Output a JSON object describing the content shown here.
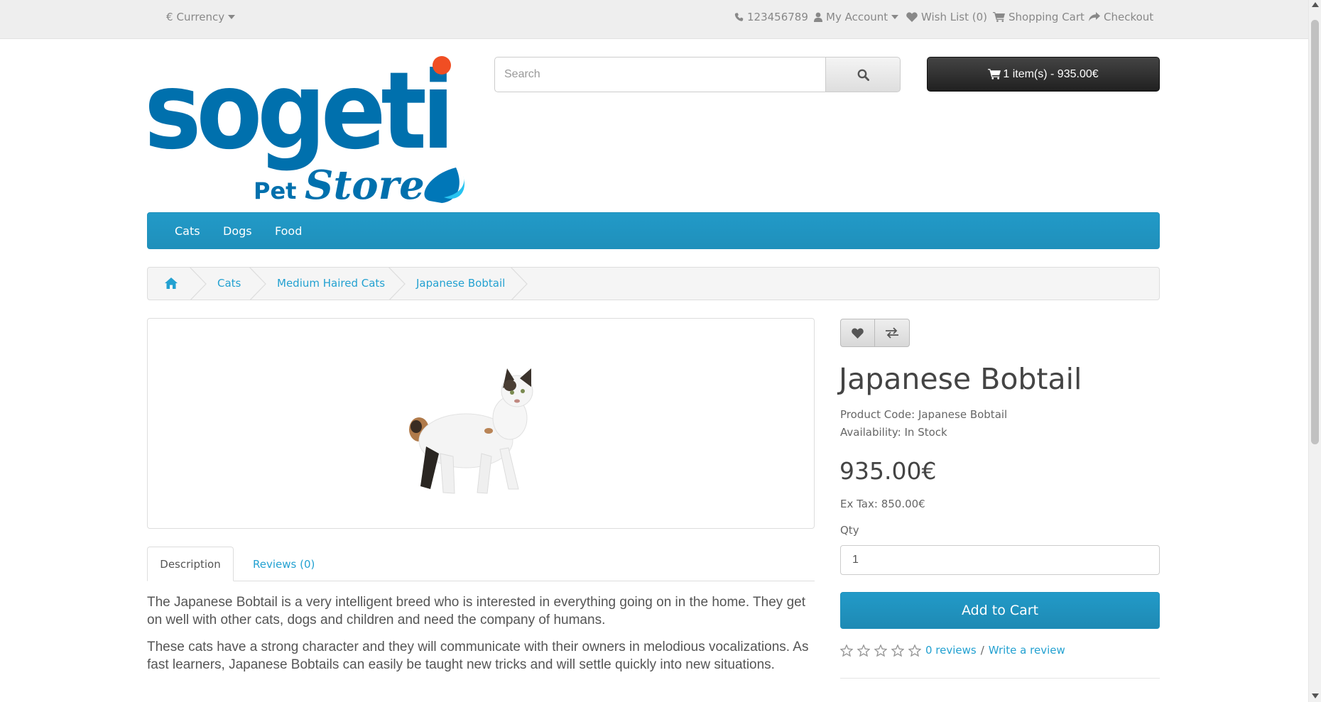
{
  "topbar": {
    "currency_symbol": "€",
    "currency_label": "Currency",
    "phone": "123456789",
    "my_account": "My Account",
    "wish_list": "Wish List (0)",
    "shopping_cart": "Shopping Cart",
    "checkout": "Checkout"
  },
  "logo": {
    "brand": "sogeti",
    "sub1": "Pet",
    "sub2": "Store"
  },
  "search": {
    "placeholder": "Search"
  },
  "cart": {
    "label": "1 item(s) - 935.00€"
  },
  "menu": {
    "items": [
      "Cats",
      "Dogs",
      "Food"
    ]
  },
  "breadcrumb": {
    "items": [
      "Cats",
      "Medium Haired Cats",
      "Japanese Bobtail"
    ]
  },
  "tabs": {
    "description": "Description",
    "reviews": "Reviews (0)"
  },
  "description": {
    "paragraphs": [
      "The Japanese Bobtail is a very intelligent breed who is interested in everything going on in the home. They get on well with other cats, dogs and children and need the company of humans.",
      "These cats have a strong character and they will communicate with their owners in melodious vocalizations. As fast learners, Japanese Bobtails can easily be taught new tricks and will settle quickly into new situations."
    ]
  },
  "product": {
    "title": "Japanese Bobtail",
    "code": "Product Code: Japanese Bobtail",
    "availability": "Availability: In Stock",
    "price": "935.00€",
    "ex_tax": "Ex Tax: 850.00€",
    "qty_label": "Qty",
    "qty_value": "1",
    "add_to_cart": "Add to Cart",
    "reviews_link": "0 reviews",
    "separator": "/",
    "write_review": "Write a review",
    "rating": 0,
    "rating_max": 5
  },
  "colors": {
    "accent": "#229ac8",
    "link": "#23a1d1",
    "logo_blue": "#0070ad",
    "logo_dot": "#f04e23"
  },
  "icons": [
    "caret-down-icon",
    "phone-icon",
    "user-icon",
    "heart-icon",
    "cart-icon",
    "share-icon",
    "search-icon",
    "home-icon",
    "exchange-icon",
    "star-icon"
  ]
}
